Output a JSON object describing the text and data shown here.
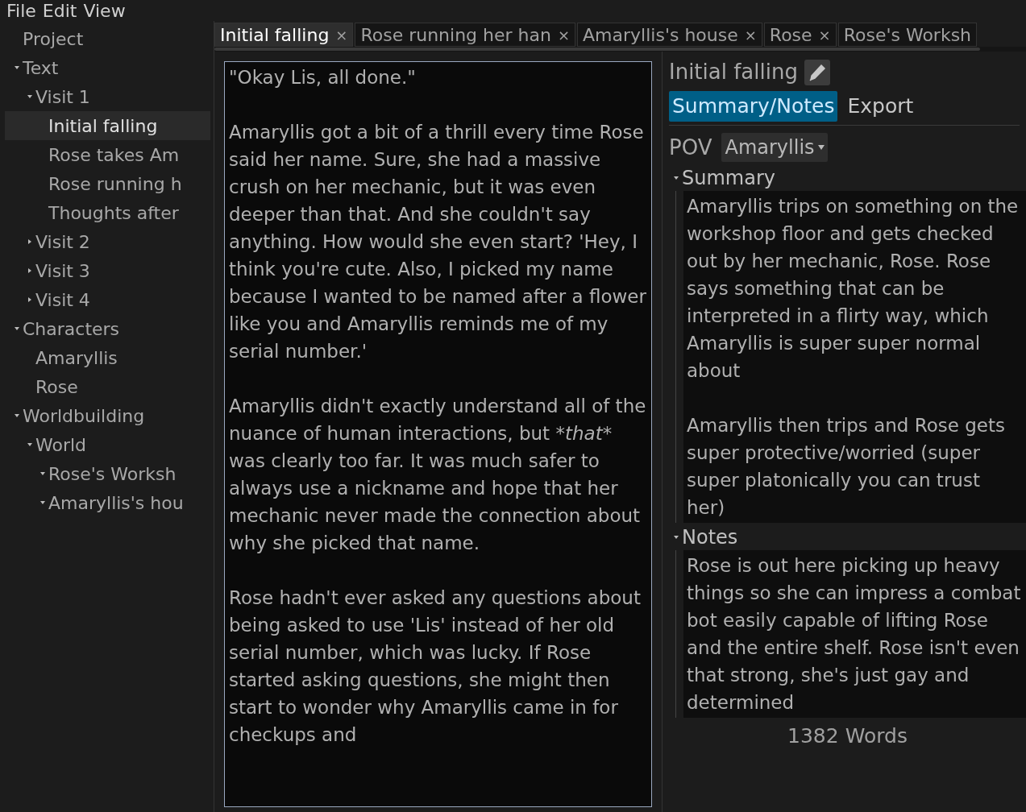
{
  "menu": [
    "File",
    "Edit",
    "View"
  ],
  "tree": [
    {
      "label": "Project",
      "selected": false
    },
    {
      "label": "Text",
      "selected": false,
      "expanded": true,
      "children": [
        {
          "label": "Visit 1",
          "selected": false,
          "expanded": true,
          "children": [
            {
              "label": "Initial falling",
              "selected": true
            },
            {
              "label": "Rose takes Am",
              "selected": false
            },
            {
              "label": "Rose running h",
              "selected": false
            },
            {
              "label": "Thoughts after",
              "selected": false
            }
          ]
        },
        {
          "label": "Visit 2",
          "selected": false,
          "expanded": false
        },
        {
          "label": "Visit 3",
          "selected": false,
          "expanded": false
        },
        {
          "label": "Visit 4",
          "selected": false,
          "expanded": false
        }
      ]
    },
    {
      "label": "Characters",
      "selected": false,
      "expanded": true,
      "children": [
        {
          "label": "Amaryllis",
          "selected": false
        },
        {
          "label": "Rose",
          "selected": false
        }
      ]
    },
    {
      "label": "Worldbuilding",
      "selected": false,
      "expanded": true,
      "children": [
        {
          "label": "World",
          "selected": false,
          "expanded": true,
          "children": [
            {
              "label": "Rose's Worksh",
              "selected": false,
              "expanded": true
            },
            {
              "label": "Amaryllis's hou",
              "selected": false,
              "expanded": true
            }
          ]
        }
      ]
    }
  ],
  "tabs": [
    {
      "label": "Initial falling",
      "selected": true,
      "close": "×"
    },
    {
      "label": "Rose running her han",
      "selected": false,
      "close": "×"
    },
    {
      "label": "Amaryllis's house",
      "selected": false,
      "close": "×"
    },
    {
      "label": "Rose",
      "selected": false,
      "close": "×"
    },
    {
      "label": "Rose's Worksh",
      "selected": false
    }
  ],
  "editor": {
    "paragraphs": [
      [
        {
          "text": "\"Okay Lis, all done.\"",
          "italic": false
        }
      ],
      [
        {
          "text": "Amaryllis got a bit of a thrill every time Rose said her name. Sure, she had a massive crush on her mechanic, but it was even deeper than that. And she couldn't say anything. How would she even start? 'Hey, I think you're cute. Also, I picked my name because I wanted to be named after a flower like you and Amaryllis reminds me of my serial number.'",
          "italic": false
        }
      ],
      [
        {
          "text": "Amaryllis didn't exactly understand all of the nuance of human interactions, but ",
          "italic": false
        },
        {
          "text": "*that*",
          "italic": true
        },
        {
          "text": " was clearly too far. It was much safer to always use a nickname and hope that her mechanic never made the connection about why she picked that name.",
          "italic": false
        }
      ],
      [
        {
          "text": "Rose hadn't ever asked any questions about being asked to use 'Lis' instead of her old serial number, which was lucky. If Rose started asking questions, she might then start to wonder why Amaryllis came in for checkups and",
          "italic": false
        }
      ]
    ]
  },
  "inspector": {
    "title": "Initial falling",
    "tabs": [
      {
        "label": "Summary/Notes",
        "selected": true
      },
      {
        "label": "Export",
        "selected": false
      }
    ],
    "pov_label": "POV",
    "pov_value": "Amaryllis",
    "sections": [
      {
        "label": "Summary",
        "expanded": true,
        "paragraphs": [
          "Amaryllis trips on something on the workshop floor and gets checked out by her mechanic, Rose. Rose says something that can be interpreted in a flirty way, which Amaryllis is super super normal about",
          "Amaryllis then trips and Rose gets super protective/worried (super super platonically you can trust her)"
        ]
      },
      {
        "label": "Notes",
        "expanded": true,
        "paragraphs": [
          "Rose is out here picking up heavy things so she can impress a combat bot easily capable of lifting Rose and the entire shelf. Rose isn't even that strong, she's just gay and determined"
        ]
      }
    ],
    "word_count": "1382 Words"
  }
}
